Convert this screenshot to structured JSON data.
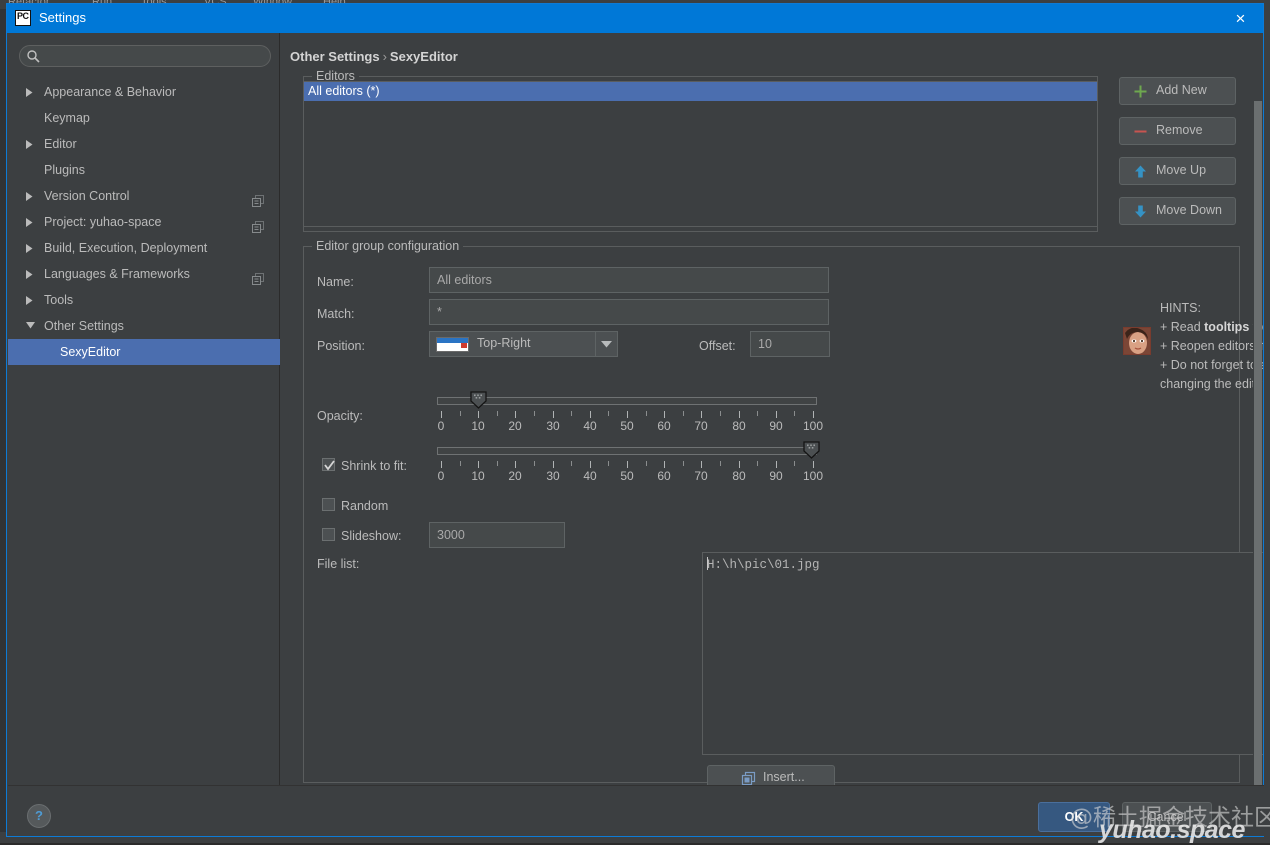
{
  "background": {
    "menu_items": [
      "Refactor",
      "Run",
      "Tools",
      "VCS",
      "Window",
      "Help"
    ]
  },
  "titlebar": {
    "app_icon": "pycharm-icon",
    "app_icon_text": "PC",
    "title": "Settings",
    "close_icon": "×"
  },
  "search": {
    "placeholder": "",
    "value": "",
    "icon": "search-icon"
  },
  "sidebar": {
    "items": [
      {
        "label": "Appearance & Behavior",
        "level": 1,
        "arrow": "collapsed",
        "selected": false,
        "copy_icon": false
      },
      {
        "label": "Keymap",
        "level": 1,
        "arrow": "none",
        "selected": false,
        "copy_icon": false
      },
      {
        "label": "Editor",
        "level": 1,
        "arrow": "collapsed",
        "selected": false,
        "copy_icon": false
      },
      {
        "label": "Plugins",
        "level": 1,
        "arrow": "none",
        "selected": false,
        "copy_icon": false
      },
      {
        "label": "Version Control",
        "level": 1,
        "arrow": "collapsed",
        "selected": false,
        "copy_icon": true
      },
      {
        "label": "Project: yuhao-space",
        "level": 1,
        "arrow": "collapsed",
        "selected": false,
        "copy_icon": true
      },
      {
        "label": "Build, Execution, Deployment",
        "level": 1,
        "arrow": "collapsed",
        "selected": false,
        "copy_icon": false
      },
      {
        "label": "Languages & Frameworks",
        "level": 1,
        "arrow": "collapsed",
        "selected": false,
        "copy_icon": true
      },
      {
        "label": "Tools",
        "level": 1,
        "arrow": "collapsed",
        "selected": false,
        "copy_icon": false
      },
      {
        "label": "Other Settings",
        "level": 1,
        "arrow": "expanded",
        "selected": false,
        "copy_icon": false
      },
      {
        "label": "SexyEditor",
        "level": 2,
        "arrow": "none",
        "selected": true,
        "copy_icon": false
      }
    ]
  },
  "breadcrumb": {
    "root": "Other Settings",
    "separator": "›",
    "leaf": "SexyEditor"
  },
  "editors_group": {
    "title": "Editors",
    "rows": [
      {
        "label": "All editors (*)",
        "selected": true
      }
    ]
  },
  "side_buttons": [
    {
      "label": "Add New",
      "icon": "plus-icon",
      "color": "#6ea84f"
    },
    {
      "label": "Remove",
      "icon": "minus-icon",
      "color": "#c75450"
    },
    {
      "label": "Move Up",
      "icon": "arrow-up-icon",
      "color": "#3592c4"
    },
    {
      "label": "Move Down",
      "icon": "arrow-down-icon",
      "color": "#3592c4"
    }
  ],
  "config_group": {
    "title": "Editor group configuration",
    "name_label": "Name:",
    "name_value": "All editors",
    "match_label": "Match:",
    "match_value": "*",
    "position_label": "Position:",
    "position_value": "Top-Right",
    "position_icon": "position-top-right-icon",
    "offset_label": "Offset:",
    "offset_value": "10",
    "opacity_label": "Opacity:",
    "shrink_label": "Shrink to fit:",
    "shrink_checked": true,
    "random_label": "Random",
    "random_checked": false,
    "slideshow_label": "Slideshow:",
    "slideshow_checked": false,
    "slideshow_value": "3000",
    "filelist_label": "File list:",
    "filelist_value": "H:\\h\\pic\\01.jpg",
    "insert_label": "Insert...",
    "insert_icon": "insert-icon"
  },
  "sliders": {
    "ticks": [
      0,
      10,
      20,
      30,
      40,
      50,
      60,
      70,
      80,
      90,
      100
    ],
    "opacity": {
      "name": "opacity-slider",
      "min": 0,
      "max": 100,
      "value": 10
    },
    "shrink": {
      "name": "shrink-slider",
      "min": 0,
      "max": 100,
      "value": 100
    }
  },
  "hints": {
    "title": "HINTS:",
    "avatar": "hint-avatar-image",
    "lines": [
      {
        "prefix": "+ Read ",
        "bold": "tooltips",
        "suffix": " for more help."
      },
      {
        "prefix": "+ Reopen editors if changes are not visible.",
        "bold": "",
        "suffix": ""
      },
      {
        "prefix": "+ Do not forget to apply changes before",
        "bold": "",
        "suffix": ""
      },
      {
        "prefix": "changing the editor group.",
        "bold": "",
        "suffix": ""
      }
    ]
  },
  "footer": {
    "help_label": "?",
    "ok_label": "OK",
    "cancel_label": "Cancel"
  },
  "watermark": {
    "line1": "@稀土掘金技术社区",
    "line2": "yuhao.space"
  },
  "colors": {
    "accent_blue": "#0078d7",
    "selection_blue": "#4b6eaf",
    "panel_bg": "#3c3f41",
    "field_bg": "#45494a",
    "text": "#bbbbbb"
  }
}
